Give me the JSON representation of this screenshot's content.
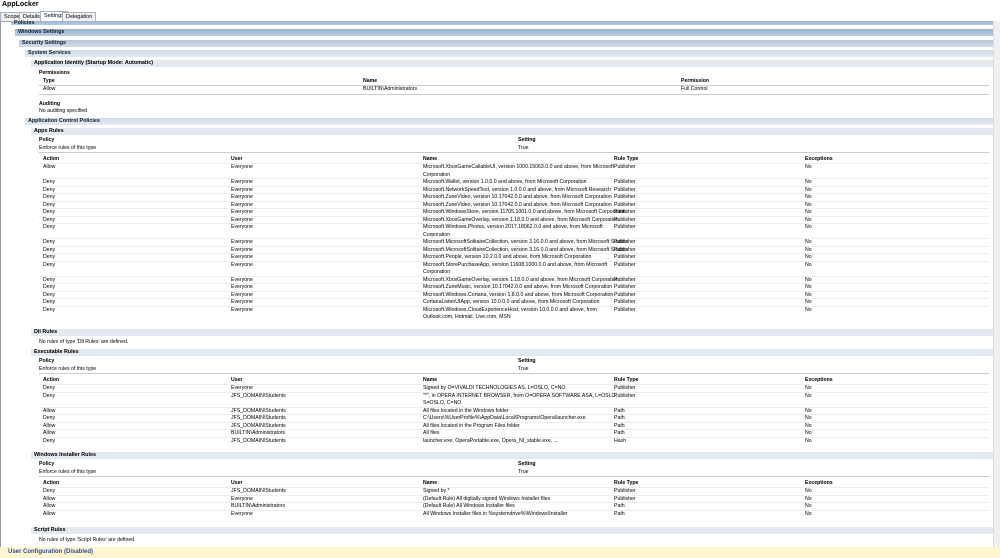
{
  "app": {
    "title": "AppLocker"
  },
  "tabs": [
    "Scope",
    "Details",
    "Settings",
    "Delegation"
  ],
  "sections": {
    "policies": "Policies",
    "windows_settings": "Windows Settings",
    "security_settings": "Security Settings",
    "system_services": "System Services",
    "app_identity": "Application Identity (Startup Mode: Automatic)",
    "permissions": "Permissions",
    "auditing": "Auditing",
    "no_auditing": "No auditing specified",
    "acp": "Application Control Policies",
    "appx": "Appx Rules",
    "dll": "Dll Rules",
    "dll_none": "No rules of type 'Dll Rules' are defined.",
    "exe": "Executable Rules",
    "msi": "Windows Installer Rules",
    "script": "Script Rules",
    "script_none": "No rules of type 'Script Rules' are defined.",
    "user_config": "User Configuration (Disabled)"
  },
  "permissions_table": {
    "headers": [
      "Type",
      "Name",
      "Permission"
    ],
    "rows": [
      [
        "Allow",
        "BUILTIN\\Administrators",
        "Full Control"
      ]
    ]
  },
  "policy_header": {
    "policy": "Policy",
    "setting": "Setting",
    "enforce": "Enforce rules of this type",
    "value": "True"
  },
  "rule_headers": [
    "Action",
    "User",
    "Name",
    "Rule Type",
    "Exceptions"
  ],
  "appx_rules": [
    [
      "Allow",
      "Everyone",
      "Microsoft.XboxGameCallableUI, version 1000.15063.0.0 and above, from Microsoft",
      "Publisher",
      "No",
      "Corporation"
    ],
    [
      "Deny",
      "Everyone",
      "Microsoft.Wallet, version 1.0.0.0 and above, from Microsoft Corporation",
      "Publisher",
      "No",
      ""
    ],
    [
      "Deny",
      "Everyone",
      "Microsoft.NetworkSpeedTest, version 1.0.0.0 and above, from Microsoft Research",
      "Publisher",
      "No",
      ""
    ],
    [
      "Deny",
      "Everyone",
      "Microsoft.ZuneVideo, version 10.17042.0.0 and above, from Microsoft Corporation",
      "Publisher",
      "No",
      ""
    ],
    [
      "Deny",
      "Everyone",
      "Microsoft.ZuneVideo, version 10.17042.0.0 and above, from Microsoft Corporation",
      "Publisher",
      "No",
      ""
    ],
    [
      "Deny",
      "Everyone",
      "Microsoft.WindowsStore, version 11705.1001.0.0 and above, from Microsoft Corporation",
      "Publisher",
      "No",
      ""
    ],
    [
      "Deny",
      "Everyone",
      "Microsoft.XboxGameOverlay, version 1.18.0.0 and above, from Microsoft Corporation",
      "Publisher",
      "No",
      ""
    ],
    [
      "Deny",
      "Everyone",
      "Microsoft.Windows.Photos, version 2017.18062.0.0 and above, from Microsoft",
      "Publisher",
      "No",
      "Corporation"
    ],
    [
      "Deny",
      "Everyone",
      "Microsoft.MicrosoftSolitaireCollection, version 3.16.0.0 and above, from Microsoft Studios",
      "Publisher",
      "No",
      ""
    ],
    [
      "Deny",
      "Everyone",
      "Microsoft.MicrosoftSolitaireCollection, version 3.16.0.0 and above, from Microsoft Studios",
      "Publisher",
      "No",
      ""
    ],
    [
      "Deny",
      "Everyone",
      "Microsoft.People, version 10.2.0.0 and above, from Microsoft Corporation",
      "Publisher",
      "No",
      ""
    ],
    [
      "Deny",
      "Everyone",
      "Microsoft.StorePurchaseApp, version 11608.1000.0.0 and above, from Microsoft",
      "Publisher",
      "No",
      "Corporation"
    ],
    [
      "Deny",
      "Everyone",
      "Microsoft.XboxGameOverlay, version 1.18.0.0 and above, from Microsoft Corporation",
      "Publisher",
      "No",
      ""
    ],
    [
      "Deny",
      "Everyone",
      "Microsoft.ZuneMusic, version 10.17042.0.0 and above, from Microsoft Corporation",
      "Publisher",
      "No",
      ""
    ],
    [
      "Deny",
      "Everyone",
      "Microsoft.Windows.Cortana, version 1.8.0.0 and above, from Microsoft Corporation",
      "Publisher",
      "No",
      ""
    ],
    [
      "Deny",
      "Everyone",
      "CortanaListenUIApp, version 10.0.0.0 and above, from Microsoft Corporation",
      "Publisher",
      "No",
      ""
    ],
    [
      "Deny",
      "Everyone",
      "Microsoft.Windows.CloudExperienceHost, version 10.0.0.0 and above, from",
      "Publisher",
      "No",
      "Outlook.com, Hotmail, Live.com, MSN"
    ]
  ],
  "exe_rules": [
    [
      "Deny",
      "Everyone",
      "Signed by O=VIVALDI TECHNOLOGIES AS, L=OSLO, C=NO",
      "Publisher",
      "No",
      ""
    ],
    [
      "Deny",
      "JFS_DOMAIN\\Students",
      "\"*\", in OPERA INTERNET BROWSER, from O=OPERA SOFTWARE ASA, L=OSLO,",
      "Publisher",
      "No",
      "S=OSLO, C=NO"
    ],
    [
      "Allow",
      "JFS_DOMAIN\\Students",
      "All files located in the Windows folder",
      "Path",
      "No",
      ""
    ],
    [
      "Deny",
      "JFS_DOMAIN\\Students",
      "C:\\Users\\%UserProfile%\\AppData\\Local\\Programs\\Opera\\launcher.exe",
      "Path",
      "No",
      ""
    ],
    [
      "Allow",
      "JFS_DOMAIN\\Students",
      "All files located in the Program Files folder",
      "Path",
      "No",
      ""
    ],
    [
      "Allow",
      "BUILTIN\\Administrators",
      "All files",
      "Path",
      "No",
      ""
    ],
    [
      "Deny",
      "JFS_DOMAIN\\Students",
      "launcher.exe, OperaPortable.exe, Opera_NI_stable.exe, ...",
      "Hash",
      "No",
      ""
    ]
  ],
  "msi_rules": [
    [
      "Deny",
      "JFS_DOMAIN\\Students",
      "Signed by *",
      "Publisher",
      "No",
      ""
    ],
    [
      "Allow",
      "Everyone",
      "(Default Rule) All digitally signed Windows Installer files",
      "Publisher",
      "No",
      ""
    ],
    [
      "Allow",
      "BUILTIN\\Administrators",
      "(Default Rule) All Windows Installer files",
      "Path",
      "No",
      ""
    ],
    [
      "Allow",
      "Everyone",
      "All Windows Installer files in %systemdrive%\\Windows\\Installer",
      "Path",
      "No",
      ""
    ]
  ]
}
